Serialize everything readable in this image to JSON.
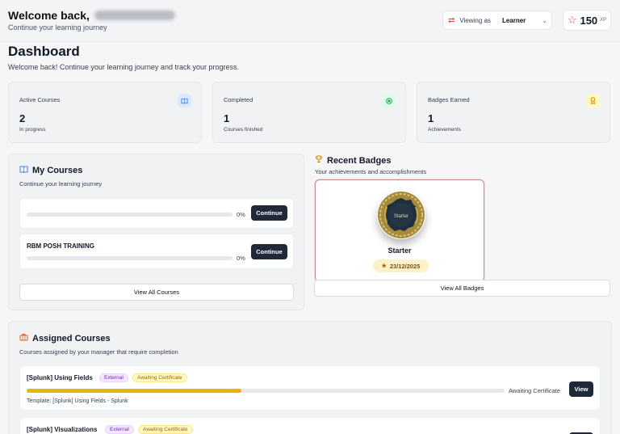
{
  "header": {
    "welcome": "Welcome back,",
    "subtitle": "Continue your learning journey",
    "viewing_label": "Viewing as",
    "viewing_value": "Learner",
    "xp_value": "150",
    "xp_unit": "XP"
  },
  "page": {
    "title": "Dashboard",
    "subtitle": "Welcome back! Continue your learning journey and track your progress."
  },
  "stats": [
    {
      "title": "Active Courses",
      "value": "2",
      "sub": "In progress",
      "icon": "book-icon",
      "color": "#3b82f6"
    },
    {
      "title": "Completed",
      "value": "1",
      "sub": "Courses finished",
      "icon": "check-circle-icon",
      "color": "#22c55e"
    },
    {
      "title": "Badges Earned",
      "value": "1",
      "sub": "Achievements",
      "icon": "award-icon",
      "color": "#eab308"
    }
  ],
  "my_courses": {
    "title": "My Courses",
    "subtitle": "Continue your learning journey",
    "items": [
      {
        "name": "",
        "progress_pct": "0%",
        "progress": 0,
        "button": "Continue"
      },
      {
        "name": "RBM POSH TRAINING",
        "progress_pct": "0%",
        "progress": 0,
        "button": "Continue"
      }
    ],
    "view_all": "View All Courses"
  },
  "recent_badges": {
    "title": "Recent Badges",
    "subtitle": "Your achievements and accomplishments",
    "badge": {
      "name": "Starter",
      "medal_text": "Starter",
      "date": "23/12/2025"
    },
    "view_all": "View All Badges"
  },
  "assigned": {
    "title": "Assigned Courses",
    "subtitle": "Courses assigned by your manager that require completion",
    "items": [
      {
        "name": "[Splunk] Using Fields",
        "tag1": "External",
        "tag2": "Awaiting Certificate",
        "status": "Awaiting Certificate",
        "progress": 0.45,
        "template": "Template: [Splunk] Using Fields - Splunk",
        "button": "View"
      },
      {
        "name": "[Splunk] Visualizations",
        "tag1": "External",
        "tag2": "Awaiting Certificate"
      }
    ]
  },
  "colors": {
    "accent_red": "#ef4444",
    "dark_button": "#1f2937",
    "progress_fill": "#eab308"
  }
}
